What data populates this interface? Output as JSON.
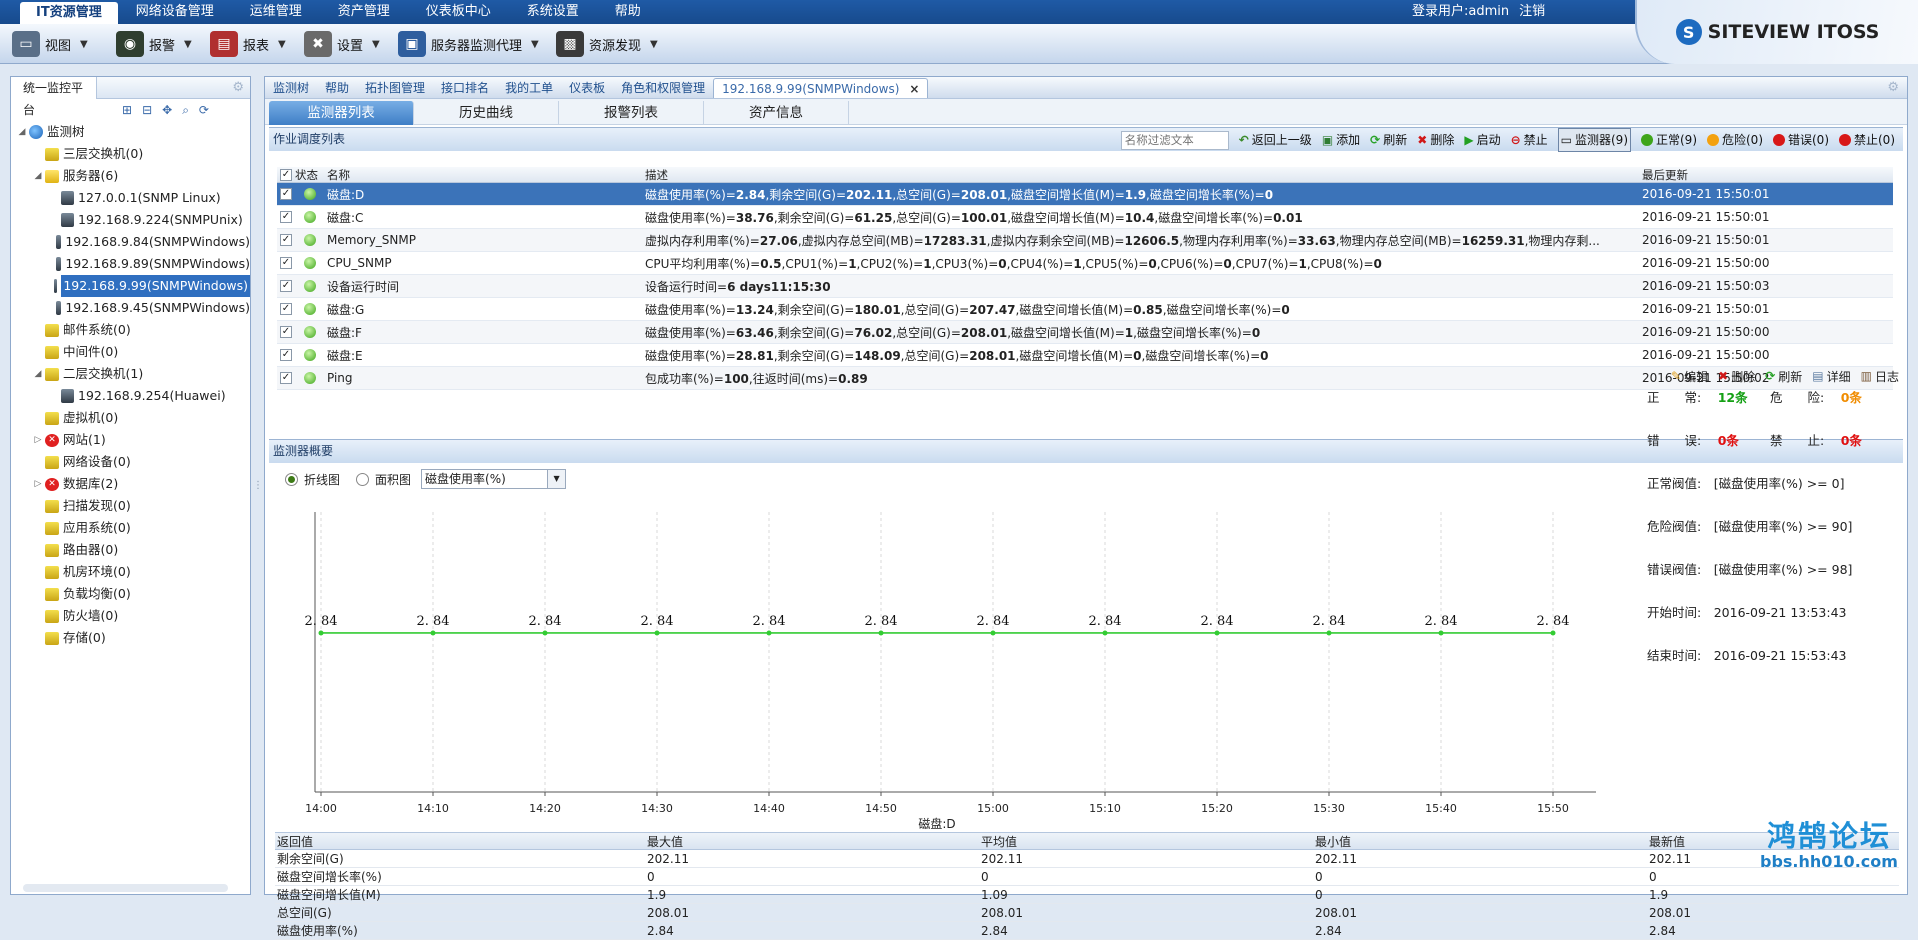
{
  "topmenu": [
    "IT资源管理",
    "网络设备管理",
    "运维管理",
    "资产管理",
    "仪表板中心",
    "系统设置",
    "帮助"
  ],
  "user": {
    "label": "登录用户:admin",
    "logout": "注销"
  },
  "brand": "SITEVIEW ITOSS",
  "toolbar": [
    {
      "label": "视图",
      "icon": "view-icon"
    },
    {
      "label": "报警",
      "icon": "alarm-icon"
    },
    {
      "label": "报表",
      "icon": "report-icon"
    },
    {
      "label": "设置",
      "icon": "settings-tools-icon"
    },
    {
      "label": "服务器监测代理",
      "icon": "server-agent-icon"
    },
    {
      "label": "资源发现",
      "icon": "discovery-icon"
    }
  ],
  "left": {
    "title": "统一监控平台",
    "tree": [
      {
        "label": "监测树",
        "level": 0,
        "kind": "globe",
        "tw": "◢"
      },
      {
        "label": "三层交换机(0)",
        "level": 1,
        "kind": "folder"
      },
      {
        "label": "服务器(6)",
        "level": 1,
        "kind": "warn",
        "tw": "◢"
      },
      {
        "label": "127.0.0.1(SNMP Linux)",
        "level": 2,
        "kind": "dev"
      },
      {
        "label": "192.168.9.224(SNMPUnix)",
        "level": 2,
        "kind": "dev"
      },
      {
        "label": "192.168.9.84(SNMPWindows)",
        "level": 2,
        "kind": "devwarn"
      },
      {
        "label": "192.168.9.89(SNMPWindows)",
        "level": 2,
        "kind": "dev"
      },
      {
        "label": "192.168.9.99(SNMPWindows)",
        "level": 2,
        "kind": "dev",
        "selected": true
      },
      {
        "label": "192.168.9.45(SNMPWindows)",
        "level": 2,
        "kind": "dev"
      },
      {
        "label": "邮件系统(0)",
        "level": 1,
        "kind": "folder"
      },
      {
        "label": "中间件(0)",
        "level": 1,
        "kind": "folder"
      },
      {
        "label": "二层交换机(1)",
        "level": 1,
        "kind": "folder",
        "tw": "◢"
      },
      {
        "label": "192.168.9.254(Huawei)",
        "level": 2,
        "kind": "dev"
      },
      {
        "label": "虚拟机(0)",
        "level": 1,
        "kind": "folder"
      },
      {
        "label": "网站(1)",
        "level": 1,
        "kind": "err",
        "tw": "▷"
      },
      {
        "label": "网络设备(0)",
        "level": 1,
        "kind": "folder"
      },
      {
        "label": "数据库(2)",
        "level": 1,
        "kind": "err",
        "tw": "▷"
      },
      {
        "label": "扫描发现(0)",
        "level": 1,
        "kind": "folder"
      },
      {
        "label": "应用系统(0)",
        "level": 1,
        "kind": "folder"
      },
      {
        "label": "路由器(0)",
        "level": 1,
        "kind": "folder"
      },
      {
        "label": "机房环境(0)",
        "level": 1,
        "kind": "folder"
      },
      {
        "label": "负载均衡(0)",
        "level": 1,
        "kind": "folder"
      },
      {
        "label": "防火墙(0)",
        "level": 1,
        "kind": "folder"
      },
      {
        "label": "存储(0)",
        "level": 1,
        "kind": "folder"
      }
    ]
  },
  "tabs": [
    "监测树",
    "帮助",
    "拓扑图管理",
    "接口排名",
    "我的工单",
    "仪表板",
    "角色和权限管理",
    "192.168.9.99(SNMPWindows)"
  ],
  "subtabs": [
    "监测器列表",
    "历史曲线",
    "报警列表",
    "资产信息"
  ],
  "jobs": {
    "title": "作业调度列表",
    "filter_placeholder": "名称过滤文本",
    "tools": [
      {
        "label": "返回上一级",
        "color": "#3a8a2a",
        "glyph": "↶"
      },
      {
        "label": "添加",
        "color": "#2f7d33",
        "glyph": "▣"
      },
      {
        "label": "刷新",
        "color": "#2aa22a",
        "glyph": "⟳"
      },
      {
        "label": "删除",
        "color": "#d01818",
        "glyph": "✖"
      },
      {
        "label": "启动",
        "color": "#22a022",
        "glyph": "▶"
      },
      {
        "label": "禁止",
        "color": "#d01818",
        "glyph": "⊖"
      }
    ],
    "monitor_label": "监测器(9)",
    "status_counts": [
      {
        "label": "正常(9)",
        "color": "#3ea51b"
      },
      {
        "label": "危险(0)",
        "color": "#f3a10f"
      },
      {
        "label": "错误(0)",
        "color": "#d81818"
      },
      {
        "label": "禁止(0)",
        "color": "#d81818"
      }
    ],
    "columns": [
      "状态",
      "名称",
      "描述",
      "最后更新"
    ],
    "rows": [
      {
        "name": "磁盘:D",
        "desc": "磁盘使用率(%)=2.84,剩余空间(G)=202.11,总空间(G)=208.01,磁盘空间增长值(M)=1.9,磁盘空间增长率(%)=0",
        "time": "2016-09-21 15:50:01",
        "selected": true
      },
      {
        "name": "磁盘:C",
        "desc": "磁盘使用率(%)=38.76,剩余空间(G)=61.25,总空间(G)=100.01,磁盘空间增长值(M)=10.4,磁盘空间增长率(%)=0.01",
        "time": "2016-09-21 15:50:01"
      },
      {
        "name": "Memory_SNMP",
        "desc": "虚拟内存利用率(%)=27.06,虚拟内存总空间(MB)=17283.31,虚拟内存剩余空间(MB)=12606.5,物理内存利用率(%)=33.63,物理内存总空间(MB)=16259.31,物理内存剩...",
        "time": "2016-09-21 15:50:01"
      },
      {
        "name": "CPU_SNMP",
        "desc": "CPU平均利用率(%)=0.5,CPU1(%)=1,CPU2(%)=1,CPU3(%)=0,CPU4(%)=1,CPU5(%)=0,CPU6(%)=0,CPU7(%)=1,CPU8(%)=0",
        "time": "2016-09-21 15:50:00"
      },
      {
        "name": "设备运行时间",
        "desc": "设备运行时间=6 days11:15:30",
        "time": "2016-09-21 15:50:03"
      },
      {
        "name": "磁盘:G",
        "desc": "磁盘使用率(%)=13.24,剩余空间(G)=180.01,总空间(G)=207.47,磁盘空间增长值(M)=0.85,磁盘空间增长率(%)=0",
        "time": "2016-09-21 15:50:01"
      },
      {
        "name": "磁盘:F",
        "desc": "磁盘使用率(%)=63.46,剩余空间(G)=76.02,总空间(G)=208.01,磁盘空间增长值(M)=1,磁盘空间增长率(%)=0",
        "time": "2016-09-21 15:50:00"
      },
      {
        "name": "磁盘:E",
        "desc": "磁盘使用率(%)=28.81,剩余空间(G)=148.09,总空间(G)=208.01,磁盘空间增长值(M)=0,磁盘空间增长率(%)=0",
        "time": "2016-09-21 15:50:00"
      },
      {
        "name": "Ping",
        "desc": "包成功率(%)=100,往返时间(ms)=0.89",
        "time": "2016-09-21 15:50:02"
      }
    ]
  },
  "overview": {
    "title": "监测器概要",
    "radio_line": "折线图",
    "radio_area": "面积图",
    "metric_select": "磁盘使用率(%)",
    "tools": [
      {
        "label": "编辑",
        "color": "#e0a020",
        "glyph": "✎"
      },
      {
        "label": "删除",
        "color": "#d01818",
        "glyph": "✖"
      },
      {
        "label": "刷新",
        "color": "#2aa22a",
        "glyph": "⟳"
      },
      {
        "label": "详细",
        "color": "#5a7aa0",
        "glyph": "▤"
      },
      {
        "label": "日志",
        "color": "#7a5a3a",
        "glyph": "▥"
      }
    ],
    "stats": {
      "normal_label": "正　　常:",
      "normal_val": "12条",
      "danger_label": "危　　险:",
      "danger_val": "0条",
      "error_label": "错　　误:",
      "error_val": "0条",
      "forbid_label": "禁　　止:",
      "forbid_val": "0条",
      "normal_threshold": "正常阀值:　[磁盘使用率(%) >= 0]",
      "danger_threshold": "危险阀值:　[磁盘使用率(%) >= 90]",
      "error_threshold": "错误阀值:　[磁盘使用率(%) >= 98]",
      "start": "开始时间:　2016-09-21 13:53:43",
      "end": "结束时间:　2016-09-21 15:53:43"
    }
  },
  "chart_data": {
    "type": "line",
    "x": [
      "14:00",
      "14:10",
      "14:20",
      "14:30",
      "14:40",
      "14:50",
      "15:00",
      "15:10",
      "15:20",
      "15:30",
      "15:40",
      "15:50"
    ],
    "series": [
      {
        "values": [
          2.84,
          2.84,
          2.84,
          2.84,
          2.84,
          2.84,
          2.84,
          2.84,
          2.84,
          2.84,
          2.84,
          2.84
        ],
        "color": "#33cc33"
      }
    ],
    "data_labels": [
      "2. 84",
      "2. 84",
      "2. 84",
      "2. 84",
      "2. 84",
      "2. 84",
      "2. 84",
      "2. 84",
      "2. 84",
      "2. 84",
      "2. 84",
      "2. 84"
    ],
    "xlabel": "磁盘:D",
    "ylabel": "",
    "grid": "vertical dashed"
  },
  "summary": {
    "columns": [
      "返回值",
      "最大值",
      "平均值",
      "最小值",
      "最新值"
    ],
    "rows": [
      [
        "剩余空间(G)",
        "202.11",
        "202.11",
        "202.11",
        "202.11"
      ],
      [
        "磁盘空间增长率(%)",
        "0",
        "0",
        "0",
        "0"
      ],
      [
        "磁盘空间增长值(M)",
        "1.9",
        "1.09",
        "0",
        "1.9"
      ],
      [
        "总空间(G)",
        "208.01",
        "208.01",
        "208.01",
        "208.01"
      ],
      [
        "磁盘使用率(%)",
        "2.84",
        "2.84",
        "2.84",
        "2.84"
      ]
    ]
  },
  "watermark": {
    "line1": "鸿鹄论坛",
    "line2": "bbs.hh010.com"
  }
}
